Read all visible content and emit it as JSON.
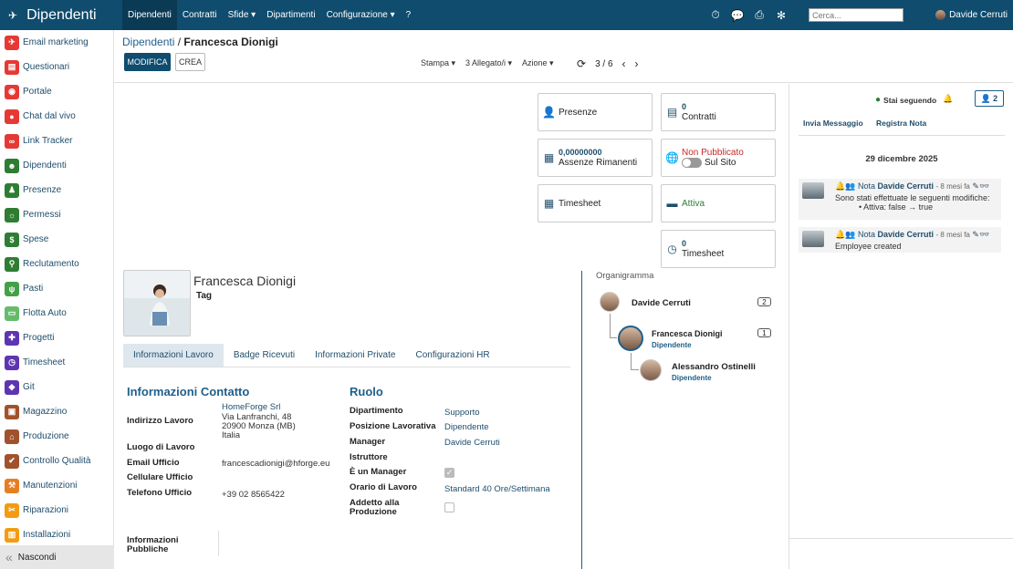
{
  "topbar": {
    "app_title": "Dipendenti",
    "menu": [
      "Dipendenti",
      "Contratti",
      "Sfide ▾",
      "Dipartimenti",
      "Configurazione ▾",
      "?"
    ],
    "search_placeholder": "Cerca...",
    "user_name": "Davide Cerruti"
  },
  "sidebar": {
    "items": [
      {
        "label": "Email marketing",
        "color": "#e53935",
        "icon": "paper-plane-icon"
      },
      {
        "label": "Questionari",
        "color": "#e53935",
        "icon": "clipboard-icon"
      },
      {
        "label": "Portale",
        "color": "#e53935",
        "icon": "globe-icon"
      },
      {
        "label": "Chat dal vivo",
        "color": "#e53935",
        "icon": "chat-icon"
      },
      {
        "label": "Link Tracker",
        "color": "#e53935",
        "icon": "link-icon"
      },
      {
        "label": "Dipendenti",
        "color": "#2e7d32",
        "icon": "people-icon"
      },
      {
        "label": "Presenze",
        "color": "#2e7d32",
        "icon": "person-icon"
      },
      {
        "label": "Permessi",
        "color": "#2e7d32",
        "icon": "sun-icon"
      },
      {
        "label": "Spese",
        "color": "#2e7d32",
        "icon": "dollar-icon"
      },
      {
        "label": "Reclutamento",
        "color": "#2e7d32",
        "icon": "search-person-icon"
      },
      {
        "label": "Pasti",
        "color": "#43a047",
        "icon": "cutlery-icon"
      },
      {
        "label": "Flotta Auto",
        "color": "#66bb6a",
        "icon": "car-icon"
      },
      {
        "label": "Progetti",
        "color": "#5e35b1",
        "icon": "puzzle-icon"
      },
      {
        "label": "Timesheet",
        "color": "#5e35b1",
        "icon": "clock-icon"
      },
      {
        "label": "Git",
        "color": "#5e35b1",
        "icon": "git-icon"
      },
      {
        "label": "Magazzino",
        "color": "#a0522d",
        "icon": "box-icon"
      },
      {
        "label": "Produzione",
        "color": "#a0522d",
        "icon": "factory-icon"
      },
      {
        "label": "Controllo Qualità",
        "color": "#a0522d",
        "icon": "wrench-icon"
      },
      {
        "label": "Manutenzioni",
        "color": "#e67e22",
        "icon": "hammer-icon"
      },
      {
        "label": "Riparazioni",
        "color": "#f39c12",
        "icon": "tools-icon"
      },
      {
        "label": "Installazioni",
        "color": "#f39c12",
        "icon": "install-icon"
      }
    ],
    "hide_label": "Nascondi"
  },
  "control": {
    "breadcrumb_parent": "Dipendenti",
    "breadcrumb_sep": "/",
    "breadcrumb_current": "Francesca Dionigi",
    "edit_label": "MODIFICA",
    "create_label": "CREA",
    "print_label": "Stampa ▾",
    "attach_label": "3 Allegato/i ▾",
    "action_label": "Azione ▾",
    "pager": "3 / 6"
  },
  "smart_buttons": {
    "presenze": "Presenze",
    "contratti_num": "0",
    "contratti_label": "Contratti",
    "assenze_num": "0,00000000",
    "assenze_label": "Assenze Rimanenti",
    "pubblicato_status": "Non Pubblicato",
    "pubblicato_label": "Sul Sito",
    "timesheet": "Timesheet",
    "attiva": "Attiva",
    "ts_num": "0",
    "ts_label": "Timesheet"
  },
  "employee": {
    "name": "Francesca Dionigi",
    "tag": "Tag"
  },
  "tabs": [
    "Informazioni Lavoro",
    "Badge Ricevuti",
    "Informazioni Private",
    "Configurazioni HR"
  ],
  "contact": {
    "title": "Informazioni Contatto",
    "address_label": "Indirizzo Lavoro",
    "address_lines": [
      "HomeForge Srl",
      "Via Lanfranchi, 48",
      "20900 Monza (MB)",
      "Italia"
    ],
    "location_label": "Luogo di Lavoro",
    "email_label": "Email Ufficio",
    "email_value": "francescadionigi@hforge.eu",
    "mobile_label": "Cellulare Ufficio",
    "phone_label": "Telefono Ufficio",
    "phone_value": "+39 02 8565422",
    "public_label_1": "Informazioni",
    "public_label_2": "Pubbliche"
  },
  "role": {
    "title": "Ruolo",
    "dept_label": "Dipartimento",
    "dept_value": "Supporto",
    "job_label": "Posizione Lavorativa",
    "job_value": "Dipendente",
    "manager_label": "Manager",
    "manager_value": "Davide Cerruti",
    "coach_label": "Istruttore",
    "is_manager_label": "È un Manager",
    "hours_label": "Orario di Lavoro",
    "hours_value": "Standard 40 Ore/Settimana",
    "prod_label_1": "Addetto alla",
    "prod_label_2": "Produzione"
  },
  "org": {
    "title": "Organigramma",
    "manager_name": "Davide Cerruti",
    "manager_count": "2",
    "self_name": "Francesca Dionigi",
    "self_job": "Dipendente",
    "self_count": "1",
    "sub_name": "Alessandro Ostinelli",
    "sub_job": "Dipendente"
  },
  "chatter": {
    "following": "Stai seguendo",
    "followers": "2",
    "send_msg": "Invia Messaggio",
    "log_note": "Registra Nota",
    "date": "29 dicembre 2025",
    "msg1_type": "Nota",
    "msg1_author": "Davide Cerruti",
    "msg1_time": "- 8 mesi fa",
    "msg1_text": "Sono stati effettuate le seguenti modifiche:",
    "msg1_change": "Attiva: false → true",
    "msg2_type": "Nota",
    "msg2_author": "Davide Cerruti",
    "msg2_time": "- 8 mesi fa",
    "msg2_text": "Employee created"
  }
}
